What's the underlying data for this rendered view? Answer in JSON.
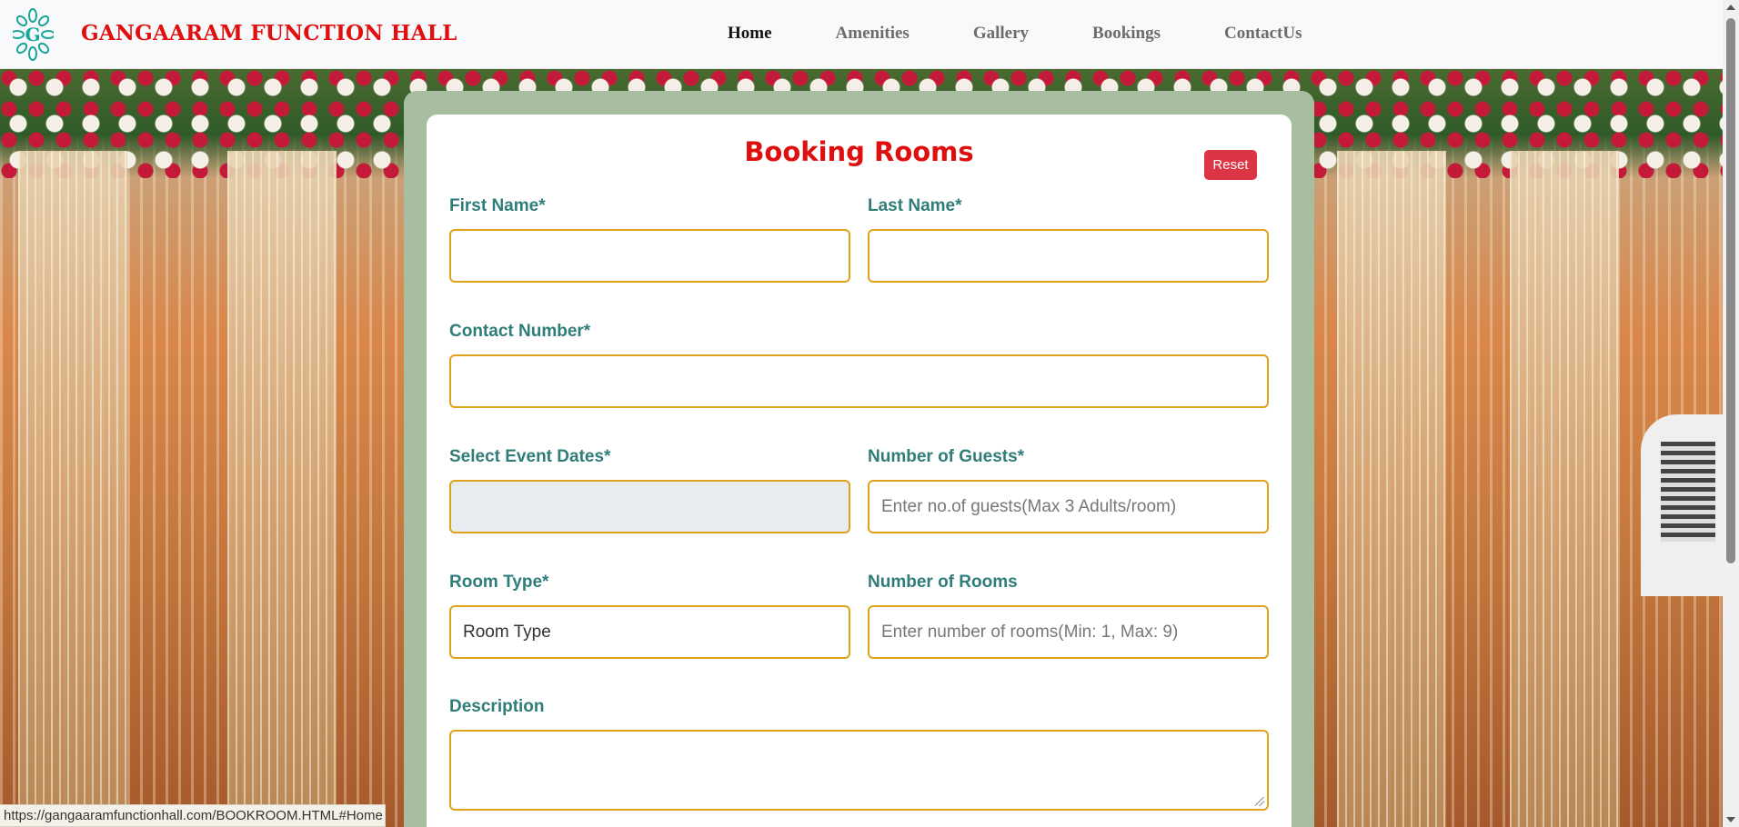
{
  "header": {
    "brand": "GANGAARAM FUNCTION HALL",
    "nav": [
      "Home",
      "Amenities",
      "Gallery",
      "Bookings",
      "ContactUs"
    ],
    "active_nav": "Home"
  },
  "form": {
    "title": "Booking Rooms",
    "reset_label": "Reset",
    "first_name_label": "First Name*",
    "last_name_label": "Last Name*",
    "contact_label": "Contact Number*",
    "event_dates_label": "Select Event Dates*",
    "guests_label": "Number of Guests*",
    "guests_placeholder": "Enter no.of guests(Max 3 Adults/room)",
    "room_type_label": "Room Type*",
    "room_type_value": "Room Type",
    "rooms_label": "Number of Rooms",
    "rooms_placeholder": "Enter number of rooms(Min: 1, Max: 9)",
    "description_label": "Description"
  },
  "status_url": "https://gangaaramfunctionhall.com/BOOKROOM.HTML#Home",
  "colors": {
    "brand": "#e01010",
    "label": "#2f7d79",
    "input_border": "#e0a21a",
    "reset_button": "#dc3545"
  },
  "icons": {
    "logo": "gangaaram-logo-icon"
  }
}
